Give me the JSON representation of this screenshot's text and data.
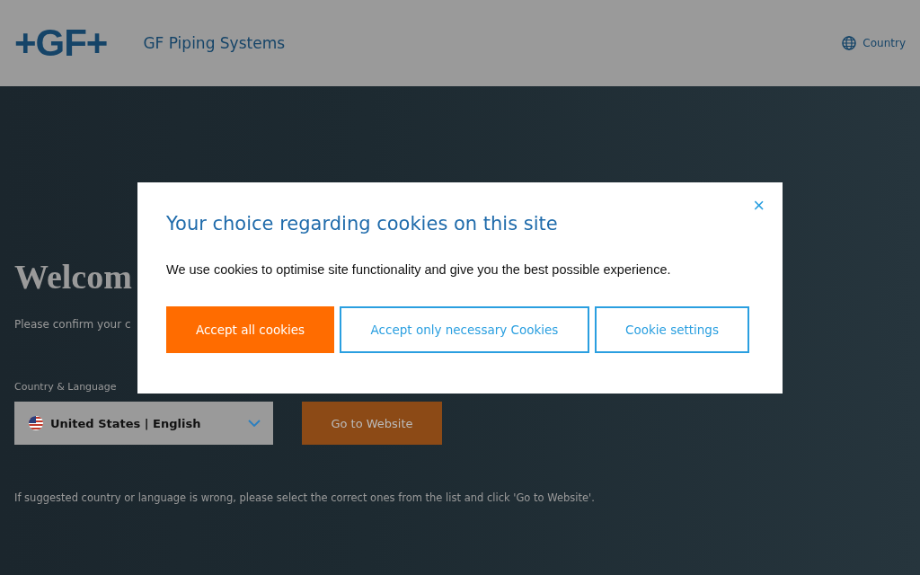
{
  "header": {
    "logo": "+GF+",
    "brand": "GF Piping Systems",
    "country_link": "Country"
  },
  "welcome": {
    "heading": "Welcom",
    "intro": "Please confirm your c",
    "field_label": "Country & Language",
    "selection": "United States | English",
    "submit": "Go to Website",
    "hint": "If suggested country or language is wrong, please select the correct ones from the list and click 'Go to Website'."
  },
  "cookie_dialog": {
    "title": "Your choice regarding cookies on this site",
    "close": "×",
    "text": "We use cookies to optimise site functionality and give you the best possible experience.",
    "buttons": [
      {
        "label": "Accept all cookies",
        "kind": "primary"
      },
      {
        "label": "Accept only necessary Cookies",
        "kind": "outline"
      },
      {
        "label": "Cookie settings",
        "kind": "outline"
      }
    ]
  }
}
